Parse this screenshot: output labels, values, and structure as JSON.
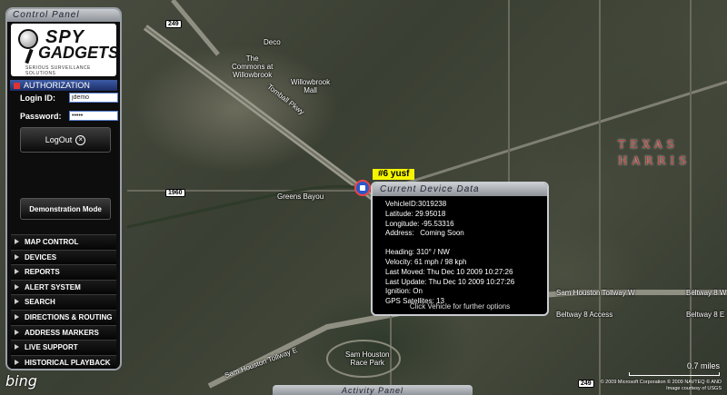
{
  "control_panel": {
    "title": "Control Panel",
    "logo_line1": "SPY",
    "logo_line2": "GADGETS",
    "logo_tagline": "SERIOUS SURVEILLANCE SOLUTIONS",
    "auth_header": "AUTHORIZATION",
    "login_label": "Login ID:",
    "login_value": "jdemo",
    "password_label": "Password:",
    "password_value": "•••••",
    "logout_label": "LogOut",
    "demo_label": "Demonstration Mode",
    "menu": [
      {
        "label": "MAP CONTROL"
      },
      {
        "label": "DEVICES"
      },
      {
        "label": "REPORTS"
      },
      {
        "label": "ALERT SYSTEM"
      },
      {
        "label": "SEARCH"
      },
      {
        "label": "DIRECTIONS & ROUTING"
      },
      {
        "label": "ADDRESS MARKERS"
      },
      {
        "label": "LIVE SUPPORT"
      },
      {
        "label": "HISTORICAL PLAYBACK"
      }
    ]
  },
  "vehicle": {
    "label": "#6 yusf"
  },
  "device_popup": {
    "title": "Current Device Data",
    "device_id": "VehicleID:3019238",
    "latitude": "Latitude: 29.95018",
    "longitude": "Longitude: -95.53316",
    "address": "Address:   Coming Soon",
    "heading": "Heading: 310° / NW",
    "velocity": "Velocity: 61 mph / 98 kph",
    "last_moved": "Last Moved: Thu Dec 10 2009 10:27:26",
    "last_update": "Last Update: Thu Dec 10 2009 10:27:26",
    "ignition": "Ignition: On",
    "gps": "GPS Satellites: 13",
    "footer": "Click Vehicle for further options"
  },
  "map": {
    "labels": {
      "deco": "Deco",
      "commons": "The\nCommons at\nWillowbrook",
      "willowbrook": "Willowbrook\nMall",
      "greens_bayou": "Greens Bayou",
      "tomball": "Tomball Pkwy",
      "sam_houston_w": "Sam Houston Tollway W",
      "sam_houston_e": "Sam Houston Tollway E",
      "race_park": "Sam Houston\nRace Park",
      "beltway": "Beltway 8 Access",
      "beltway_w": "Beltway 8 W",
      "beltway_e": "Beltway 8 E",
      "texas": "TEXAS",
      "harris": "HARRIS",
      "shield_249": "249",
      "shield_1960": "1960",
      "shield_249b": "249"
    }
  },
  "bottom": {
    "activity_panel": "Activity Panel",
    "bing": "bing",
    "scale": "0.7 miles",
    "copyright1": "© 2009 Microsoft Corporation  © 2009 NAVTEQ  © AND",
    "copyright2": "Image courtesy of USGS"
  },
  "colors": {
    "vehicle_label": "#f5f500",
    "auth_header": "#2a468a",
    "region_label": "#b5413c"
  }
}
